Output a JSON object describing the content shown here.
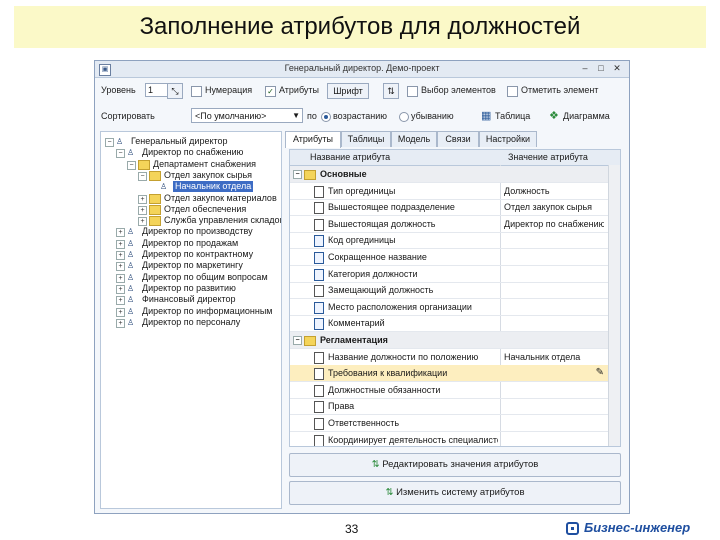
{
  "slide": {
    "title": "Заполнение атрибутов для должностей",
    "page_number": "33",
    "logo_text": "Бизнес-инженер"
  },
  "window": {
    "title": "Генеральный директор. Демо-проект",
    "icon": "app-icon",
    "controls": {
      "minimize": "–",
      "maximize": "□",
      "close": "✕"
    }
  },
  "toolbar1": {
    "level_label": "Уровень",
    "level_value": "1",
    "numbering_label": "Нумерация",
    "numbering_checked": false,
    "attributes_label": "Атрибуты",
    "attributes_checked": true,
    "font_label": "Шрифт",
    "select_elements_label": "Выбор элементов",
    "select_elements_checked": false,
    "mark_element_label": "Отметить элемент",
    "mark_element_checked": false
  },
  "toolbar2": {
    "sort_label": "Сортировать",
    "sort_value": "<По умолчанию>",
    "by_label": "по",
    "asc_label": "возрастанию",
    "desc_label": "убыванию",
    "asc_selected": true,
    "table_label": "Таблица",
    "diagram_label": "Диаграмма"
  },
  "tree": [
    {
      "label": "Генеральный директор",
      "level": 0,
      "icon": "person-icon",
      "toggle": "−"
    },
    {
      "label": "Директор по снабжению",
      "level": 1,
      "icon": "person-icon",
      "toggle": "−"
    },
    {
      "label": "Департамент снабжения",
      "level": 2,
      "icon": "folder-icon",
      "toggle": "−"
    },
    {
      "label": "Отдел закупок сырья",
      "level": 3,
      "icon": "folder-icon",
      "toggle": "−"
    },
    {
      "label": "Начальник отдела",
      "level": 4,
      "icon": "person-icon",
      "toggle": "",
      "selected": true
    },
    {
      "label": "Отдел закупок материалов",
      "level": 3,
      "icon": "folder-icon",
      "toggle": "+"
    },
    {
      "label": "Отдел обеспечения",
      "level": 3,
      "icon": "folder-icon",
      "toggle": "+"
    },
    {
      "label": "Служба управления складом",
      "level": 3,
      "icon": "folder-icon",
      "toggle": "+"
    },
    {
      "label": "Директор по производству",
      "level": 1,
      "icon": "person-icon",
      "toggle": "+"
    },
    {
      "label": "Директор по продажам",
      "level": 1,
      "icon": "person-icon",
      "toggle": "+"
    },
    {
      "label": "Директор по контрактному",
      "level": 1,
      "icon": "person-icon",
      "toggle": "+"
    },
    {
      "label": "Директор по маркетингу",
      "level": 1,
      "icon": "person-icon",
      "toggle": "+"
    },
    {
      "label": "Директор по общим вопросам",
      "level": 1,
      "icon": "person-icon",
      "toggle": "+"
    },
    {
      "label": "Директор по развитию",
      "level": 1,
      "icon": "person-icon",
      "toggle": "+"
    },
    {
      "label": "Финансовый директор",
      "level": 1,
      "icon": "person-icon",
      "toggle": "+"
    },
    {
      "label": "Директор по информационным",
      "level": 1,
      "icon": "person-icon",
      "toggle": "+"
    },
    {
      "label": "Директор по персоналу",
      "level": 1,
      "icon": "person-icon",
      "toggle": "+"
    }
  ],
  "tabs": [
    {
      "label": "Атрибуты",
      "active": true
    },
    {
      "label": "Таблицы",
      "active": false
    },
    {
      "label": "Модель",
      "active": false
    },
    {
      "label": "Связи",
      "active": false
    },
    {
      "label": "Настройки",
      "active": false
    }
  ],
  "grid": {
    "headers": [
      "Название атрибута",
      "Значение атрибута"
    ],
    "rows": [
      {
        "type": "group",
        "name": "Основные",
        "value": ""
      },
      {
        "type": "item",
        "name": "Тип оргединицы",
        "value": "Должность",
        "icon": "doc-icon"
      },
      {
        "type": "item",
        "name": "Вышестоящее подразделение",
        "value": "Отдел закупок сырья",
        "icon": "doc-icon"
      },
      {
        "type": "item",
        "name": "Вышестоящая должность",
        "value": "Директор по снабжению",
        "icon": "doc-icon"
      },
      {
        "type": "item",
        "name": "Код оргединицы",
        "value": "",
        "icon": "edit-doc-icon"
      },
      {
        "type": "item",
        "name": "Сокращенное название",
        "value": "",
        "icon": "edit-doc-icon"
      },
      {
        "type": "item",
        "name": "Категория должности",
        "value": "",
        "icon": "edit-doc-icon"
      },
      {
        "type": "item",
        "name": "Замещающий должность",
        "value": "",
        "icon": "doc-icon"
      },
      {
        "type": "item",
        "name": "Место расположения организации",
        "value": "",
        "icon": "edit-doc-icon"
      },
      {
        "type": "item",
        "name": "Комментарий",
        "value": "",
        "icon": "edit-doc-icon"
      },
      {
        "type": "group",
        "name": "Регламентация",
        "value": ""
      },
      {
        "type": "item",
        "name": "Название должности по положению",
        "value": "Начальник отдела",
        "icon": "doc-icon"
      },
      {
        "type": "item",
        "name": "Требования к квалификации",
        "value": "",
        "icon": "doc-icon",
        "highlight": true
      },
      {
        "type": "item",
        "name": "Должностные обязанности",
        "value": "",
        "icon": "doc-icon"
      },
      {
        "type": "item",
        "name": "Права",
        "value": "",
        "icon": "doc-icon"
      },
      {
        "type": "item",
        "name": "Ответственность",
        "value": "",
        "icon": "doc-icon"
      },
      {
        "type": "item",
        "name": "Координирует деятельность специалистов",
        "value": "",
        "icon": "doc-icon"
      }
    ]
  },
  "buttons": {
    "edit_values": "Редактировать значения атрибутов",
    "change_system": "Изменить систему атрибутов"
  },
  "colors": {
    "title_bg": "#fbf9c8",
    "selection": "#3d6cc4",
    "highlight_row": "#fdeebf",
    "logo": "#1f4fa0"
  }
}
